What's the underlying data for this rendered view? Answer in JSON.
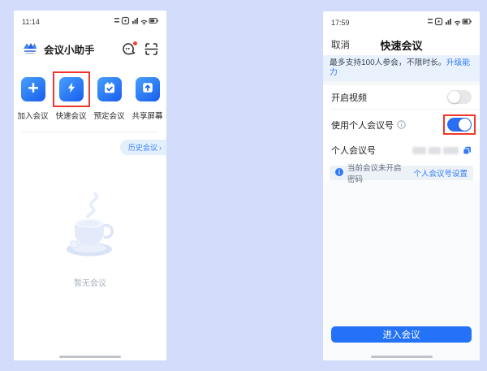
{
  "colors": {
    "page_bg": "#d3dcfa",
    "accent_blue": "#2a6ef5",
    "link_blue": "#2f7bf5",
    "highlight_red": "#f0372b",
    "banner_bg": "#e9f1fc",
    "notice_bg": "#edf2f9"
  },
  "icons": [
    "app-logo-icon",
    "chat-service-icon",
    "scan-icon",
    "plus-icon",
    "lightning-icon",
    "calendar-check-icon",
    "screen-share-icon",
    "status-icons",
    "info-icon",
    "info-filled-icon",
    "copy-icon",
    "chevron-right-icon",
    "teacup-empty-icon"
  ],
  "left": {
    "time": "11:14",
    "app_title": "会议小助手",
    "actions": [
      {
        "label": "加入会议",
        "icon": "plus-icon",
        "highlighted": false
      },
      {
        "label": "快速会议",
        "icon": "lightning-icon",
        "highlighted": true
      },
      {
        "label": "预定会议",
        "icon": "calendar-check-icon",
        "highlighted": false
      },
      {
        "label": "共享屏幕",
        "icon": "screen-share-icon",
        "highlighted": false
      }
    ],
    "history_label": "历史会议",
    "history_chevron": "›",
    "empty_text": "暂无会议"
  },
  "right": {
    "time": "17:59",
    "cancel": "取消",
    "title": "快速会议",
    "banner_text": "最多支持100人参会，不限时长。",
    "banner_link": "升级能力",
    "video_label": "开启视频",
    "video_on": false,
    "personal_toggle_label": "使用个人会议号",
    "personal_on": true,
    "personal_id_label": "个人会议号",
    "personal_id_masked": true,
    "notice_text": "当前会议未开启密码",
    "notice_link": "个人会议号设置",
    "enter_button": "进入会议"
  }
}
